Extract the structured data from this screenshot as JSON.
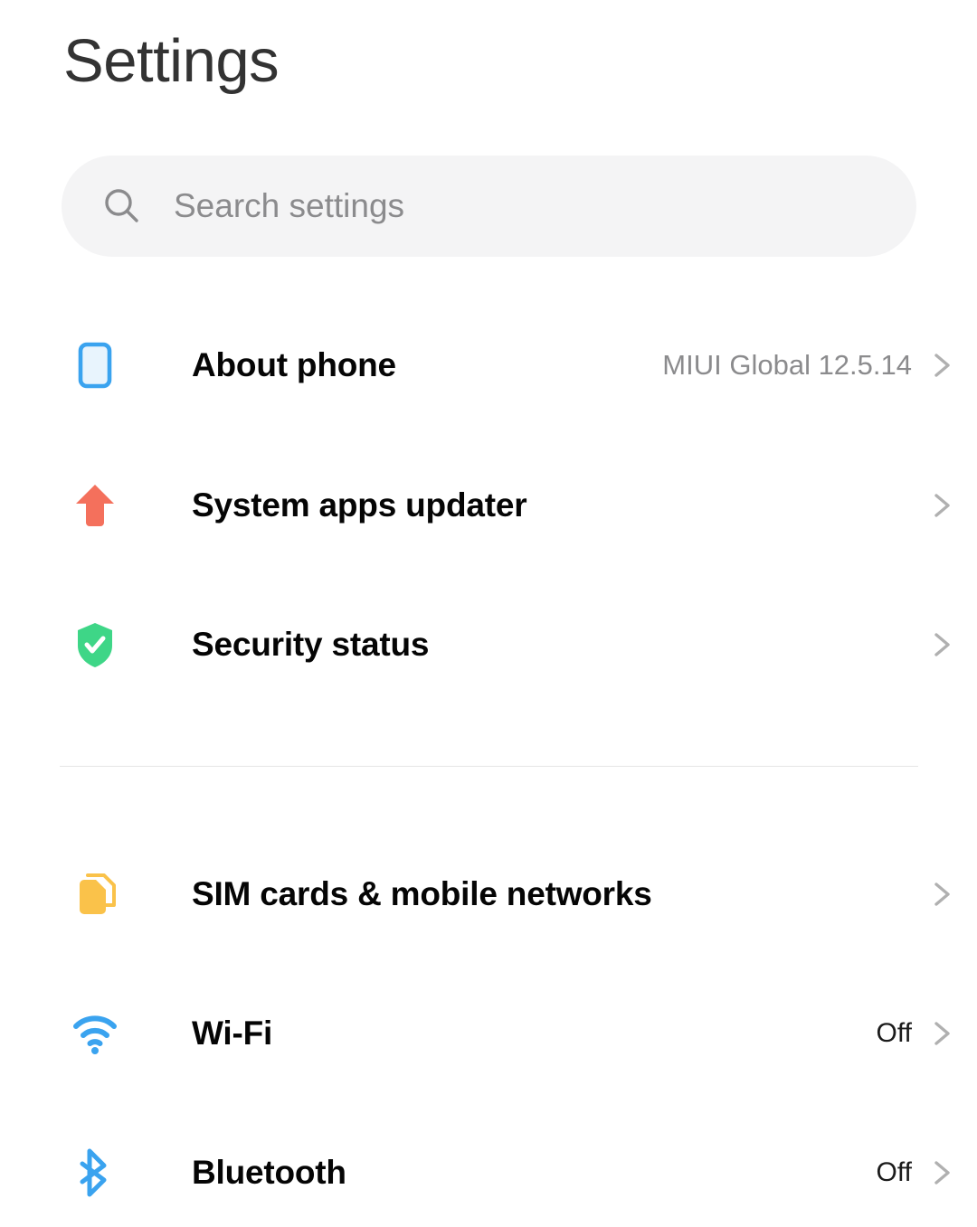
{
  "header": {
    "title": "Settings"
  },
  "search": {
    "icon": "search-icon",
    "placeholder": "Search settings",
    "value": ""
  },
  "colors": {
    "background": "#ffffff",
    "title_text": "#333333",
    "label_text": "#050505",
    "value_text": "#8b8b8d",
    "value_text_dark": "#1b1b1b",
    "search_bar_bg": "#f4f4f5",
    "divider": "#e6e6e6",
    "chevron": "#b0b0b0",
    "phone_blue": "#3aa3ef",
    "phone_blue_fill": "#e8f4fd",
    "updater_coral": "#f4705c",
    "security_green": "#3ed687",
    "sim_yellow": "#f8c councils"
  },
  "sections": [
    {
      "id": "system",
      "items": [
        {
          "id": "about-phone",
          "icon": "phone-icon",
          "label": "About phone",
          "value": "MIUI Global 12.5.14",
          "value_style": "muted",
          "chevron": "chevron-right-icon"
        },
        {
          "id": "system-apps-updater",
          "icon": "up-arrow-icon",
          "label": "System apps updater",
          "value": "",
          "value_style": "muted",
          "chevron": "chevron-right-icon"
        },
        {
          "id": "security-status",
          "icon": "shield-check-icon",
          "label": "Security status",
          "value": "",
          "value_style": "muted",
          "chevron": "chevron-right-icon"
        }
      ]
    },
    {
      "id": "connectivity",
      "items": [
        {
          "id": "sim-cards",
          "icon": "sim-card-icon",
          "label": "SIM cards & mobile networks",
          "value": "",
          "value_style": "dark",
          "chevron": "chevron-right-icon"
        },
        {
          "id": "wifi",
          "icon": "wifi-icon",
          "label": "Wi-Fi",
          "value": "Off",
          "value_style": "dark",
          "chevron": "chevron-right-icon"
        },
        {
          "id": "bluetooth",
          "icon": "bluetooth-icon",
          "label": "Bluetooth",
          "value": "Off",
          "value_style": "dark",
          "chevron": "chevron-right-icon"
        }
      ]
    }
  ]
}
